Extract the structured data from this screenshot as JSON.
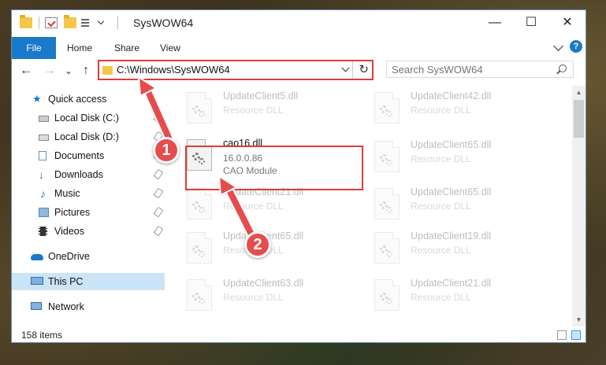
{
  "window": {
    "title": "SysWOW64",
    "controls": {
      "minimize": "—",
      "maximize": "☐",
      "close": "✕"
    }
  },
  "ribbon": {
    "file": "File",
    "tabs": [
      "Home",
      "Share",
      "View"
    ],
    "help": "?"
  },
  "nav": {
    "back": "←",
    "forward": "→",
    "recent": "⌄",
    "up": "↑",
    "address": "C:\\Windows\\SysWOW64",
    "refresh": "↻",
    "search_placeholder": "Search SysWOW64"
  },
  "sidebar": {
    "items": [
      {
        "label": "Quick access"
      },
      {
        "label": "Local Disk (C:)"
      },
      {
        "label": "Local Disk (D:)"
      },
      {
        "label": "Documents"
      },
      {
        "label": "Downloads"
      },
      {
        "label": "Music"
      },
      {
        "label": "Pictures"
      },
      {
        "label": "Videos"
      },
      {
        "label": "OneDrive"
      },
      {
        "label": "This PC"
      },
      {
        "label": "Network"
      }
    ]
  },
  "files": {
    "left": [
      {
        "name": "UpdateClient5.dll",
        "line1": "Resource DLL"
      },
      {
        "name": "cao16.dll",
        "line1": "16.0.0.86",
        "line2": "CAO Module"
      },
      {
        "name": "UpdateClient21.dll",
        "line1": "Resource DLL"
      },
      {
        "name": "UpdateClient65.dll",
        "line1": "Resource DLL"
      },
      {
        "name": "UpdateClient63.dll",
        "line1": "Resource DLL"
      }
    ],
    "right": [
      {
        "name": "UpdateClient42.dll",
        "line1": "Resource DLL"
      },
      {
        "name": "UpdateClient65.dll",
        "line1": "Resource DLL"
      },
      {
        "name": "UpdateClient65.dll",
        "line1": "Resource DLL"
      },
      {
        "name": "UpdateClient19.dll",
        "line1": "Resource DLL"
      },
      {
        "name": "UpdateClient21.dll",
        "line1": "Resource DLL"
      }
    ]
  },
  "status": {
    "count": "158 items"
  },
  "annotations": {
    "step1": "1",
    "step2": "2"
  },
  "colors": {
    "accent": "#1979ca",
    "highlight": "#e23b3b",
    "badge": "#e74c4c"
  }
}
